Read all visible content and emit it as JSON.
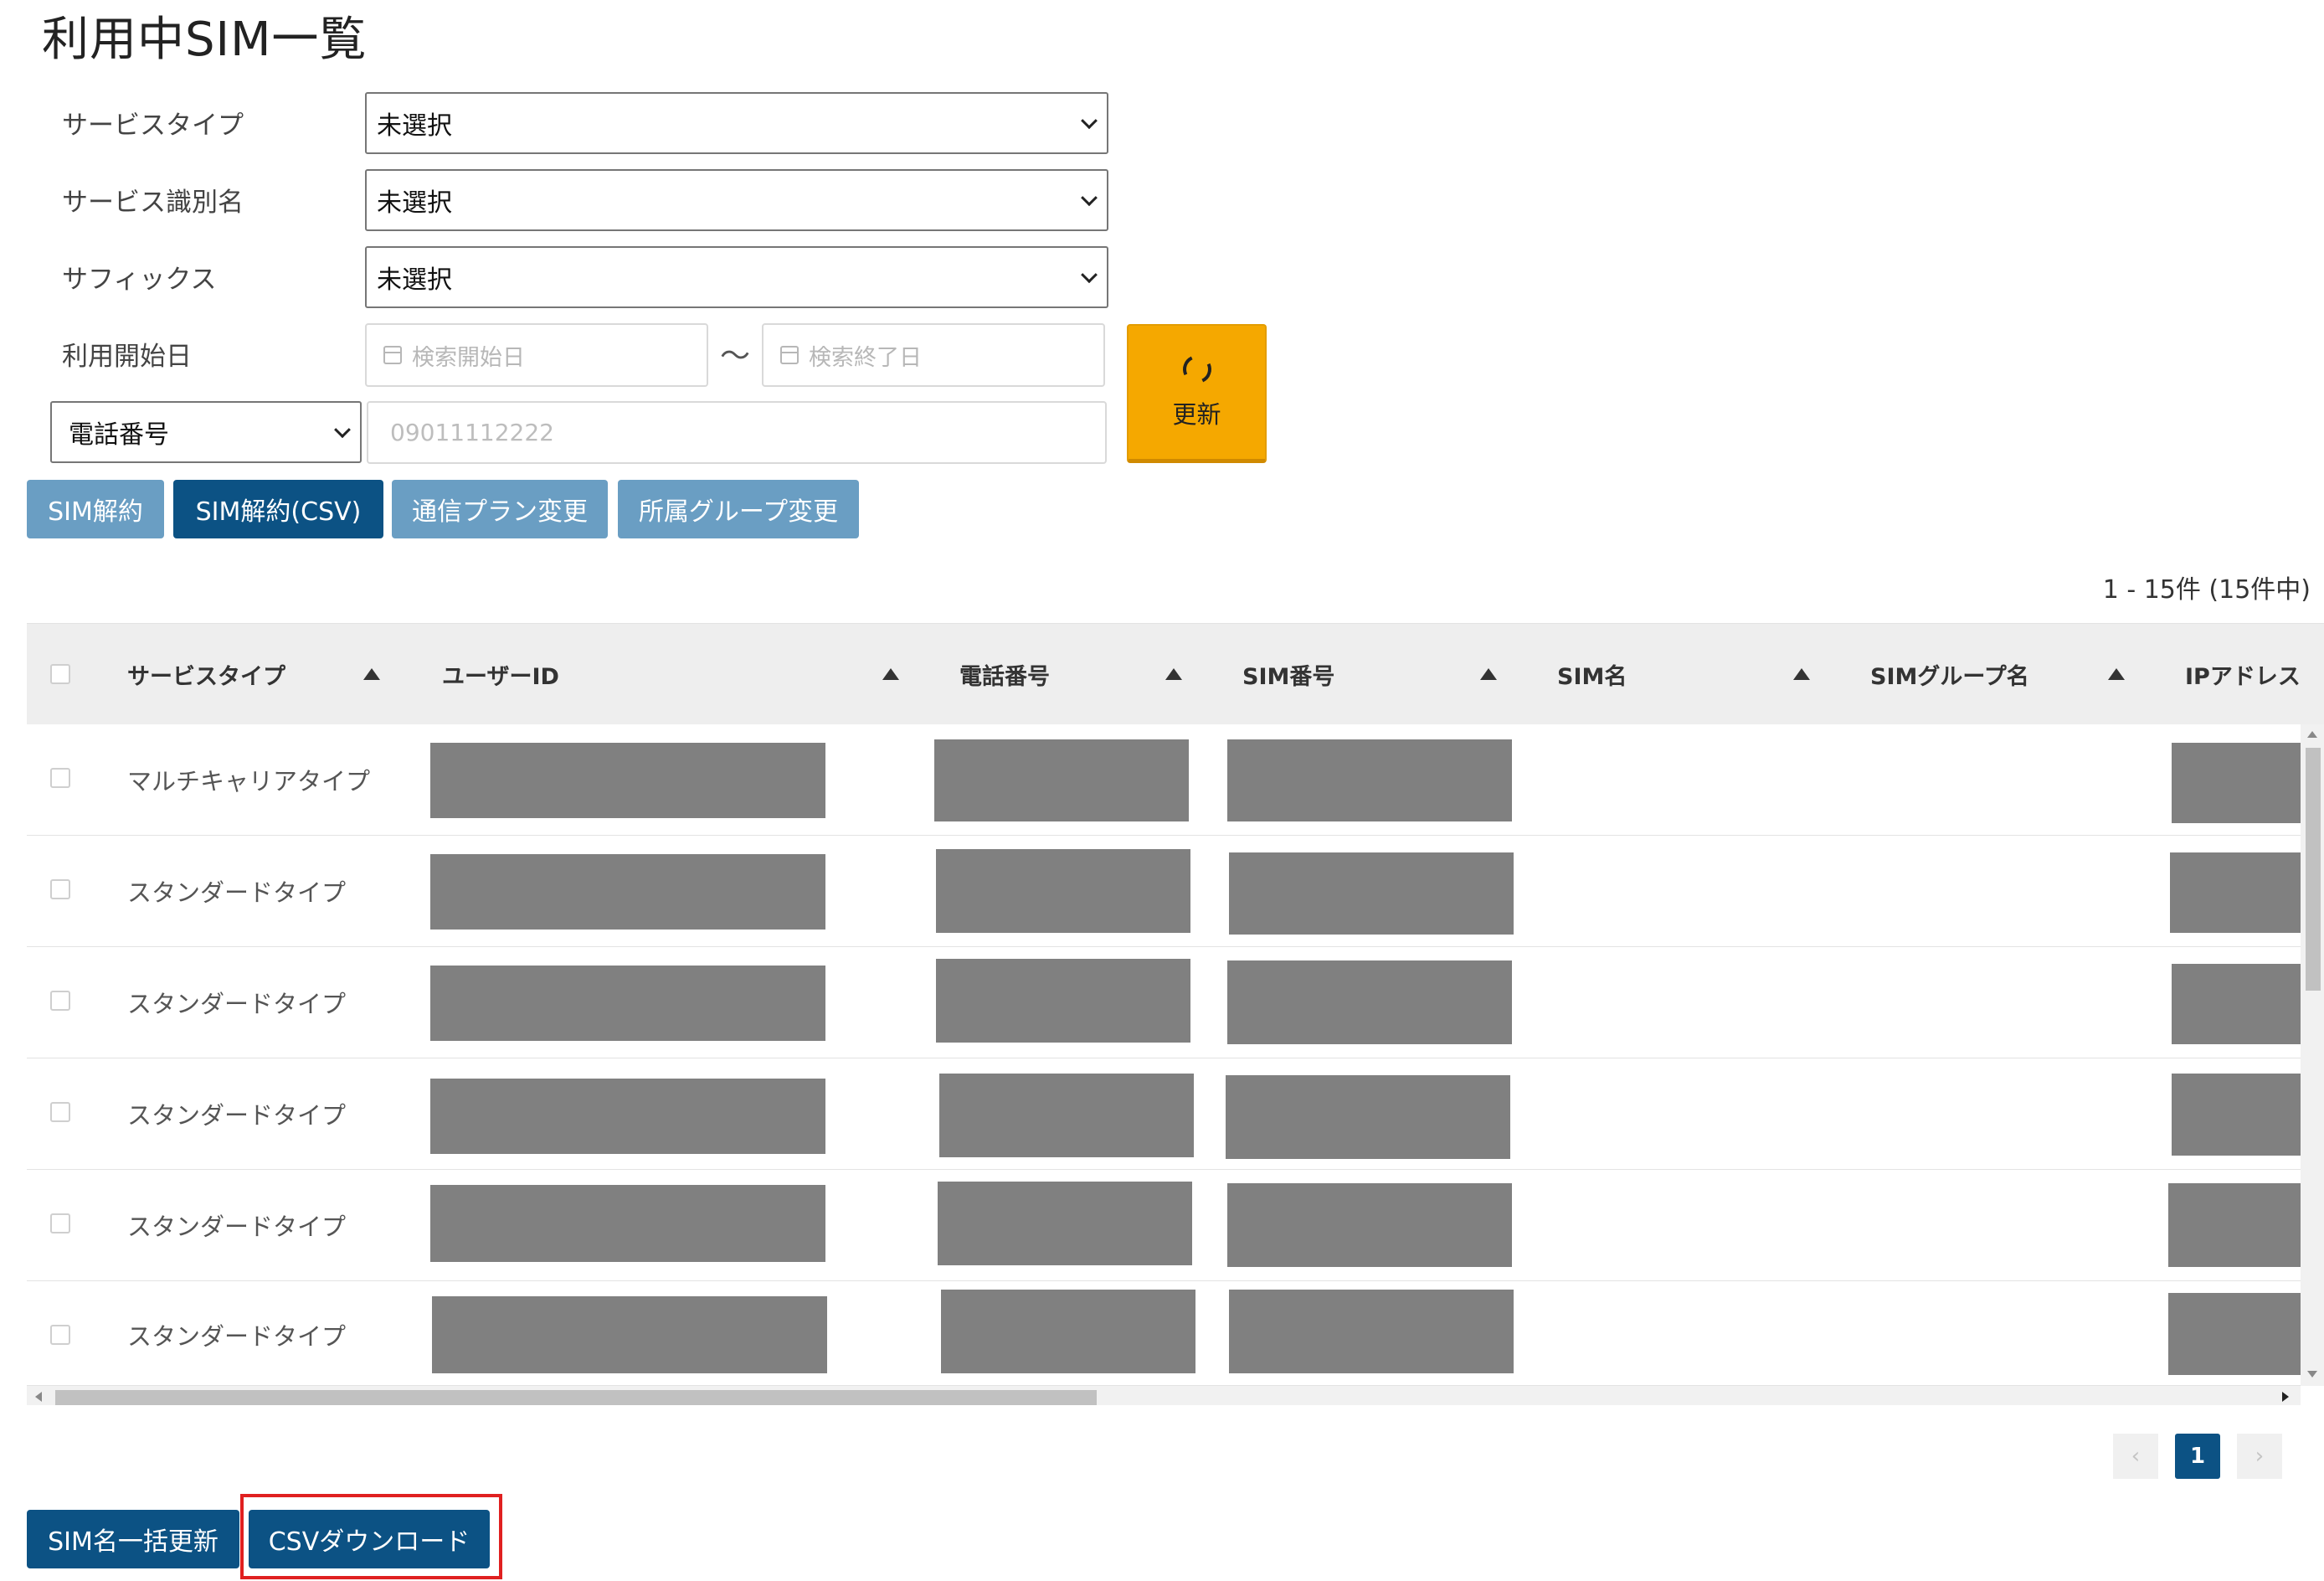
{
  "page_title": "利用中SIM一覧",
  "filters": {
    "service_type": {
      "label": "サービスタイプ",
      "value": "未選択"
    },
    "service_name": {
      "label": "サービス識別名",
      "value": "未選択"
    },
    "suffix": {
      "label": "サフィックス",
      "value": "未選択"
    },
    "start_date": {
      "label": "利用開始日",
      "from_placeholder": "検索開始日",
      "separator": "～",
      "to_placeholder": "検索終了日"
    },
    "phone": {
      "select_value": "電話番号",
      "placeholder": "09011112222"
    },
    "refresh_label": "更新"
  },
  "actions": {
    "cancel_sim": "SIM解約",
    "cancel_sim_csv": "SIM解約(CSV)",
    "change_plan": "通信プラン変更",
    "change_group": "所属グループ変更"
  },
  "result_count": "1 - 15件 (15件中)",
  "table": {
    "columns": [
      "サービスタイプ",
      "ユーザーID",
      "電話番号",
      "SIM番号",
      "SIM名",
      "SIMグループ名",
      "IPアドレス"
    ],
    "rows": [
      {
        "service_type": "マルチキャリアタイプ"
      },
      {
        "service_type": "スタンダードタイプ"
      },
      {
        "service_type": "スタンダードタイプ"
      },
      {
        "service_type": "スタンダードタイプ"
      },
      {
        "service_type": "スタンダードタイプ"
      },
      {
        "service_type": "スタンダードタイプ"
      }
    ]
  },
  "pagination": {
    "prev": "‹",
    "current": "1",
    "next": "›"
  },
  "bottom_actions": {
    "bulk_update_sim_name": "SIM名一括更新",
    "csv_download": "CSVダウンロード"
  }
}
